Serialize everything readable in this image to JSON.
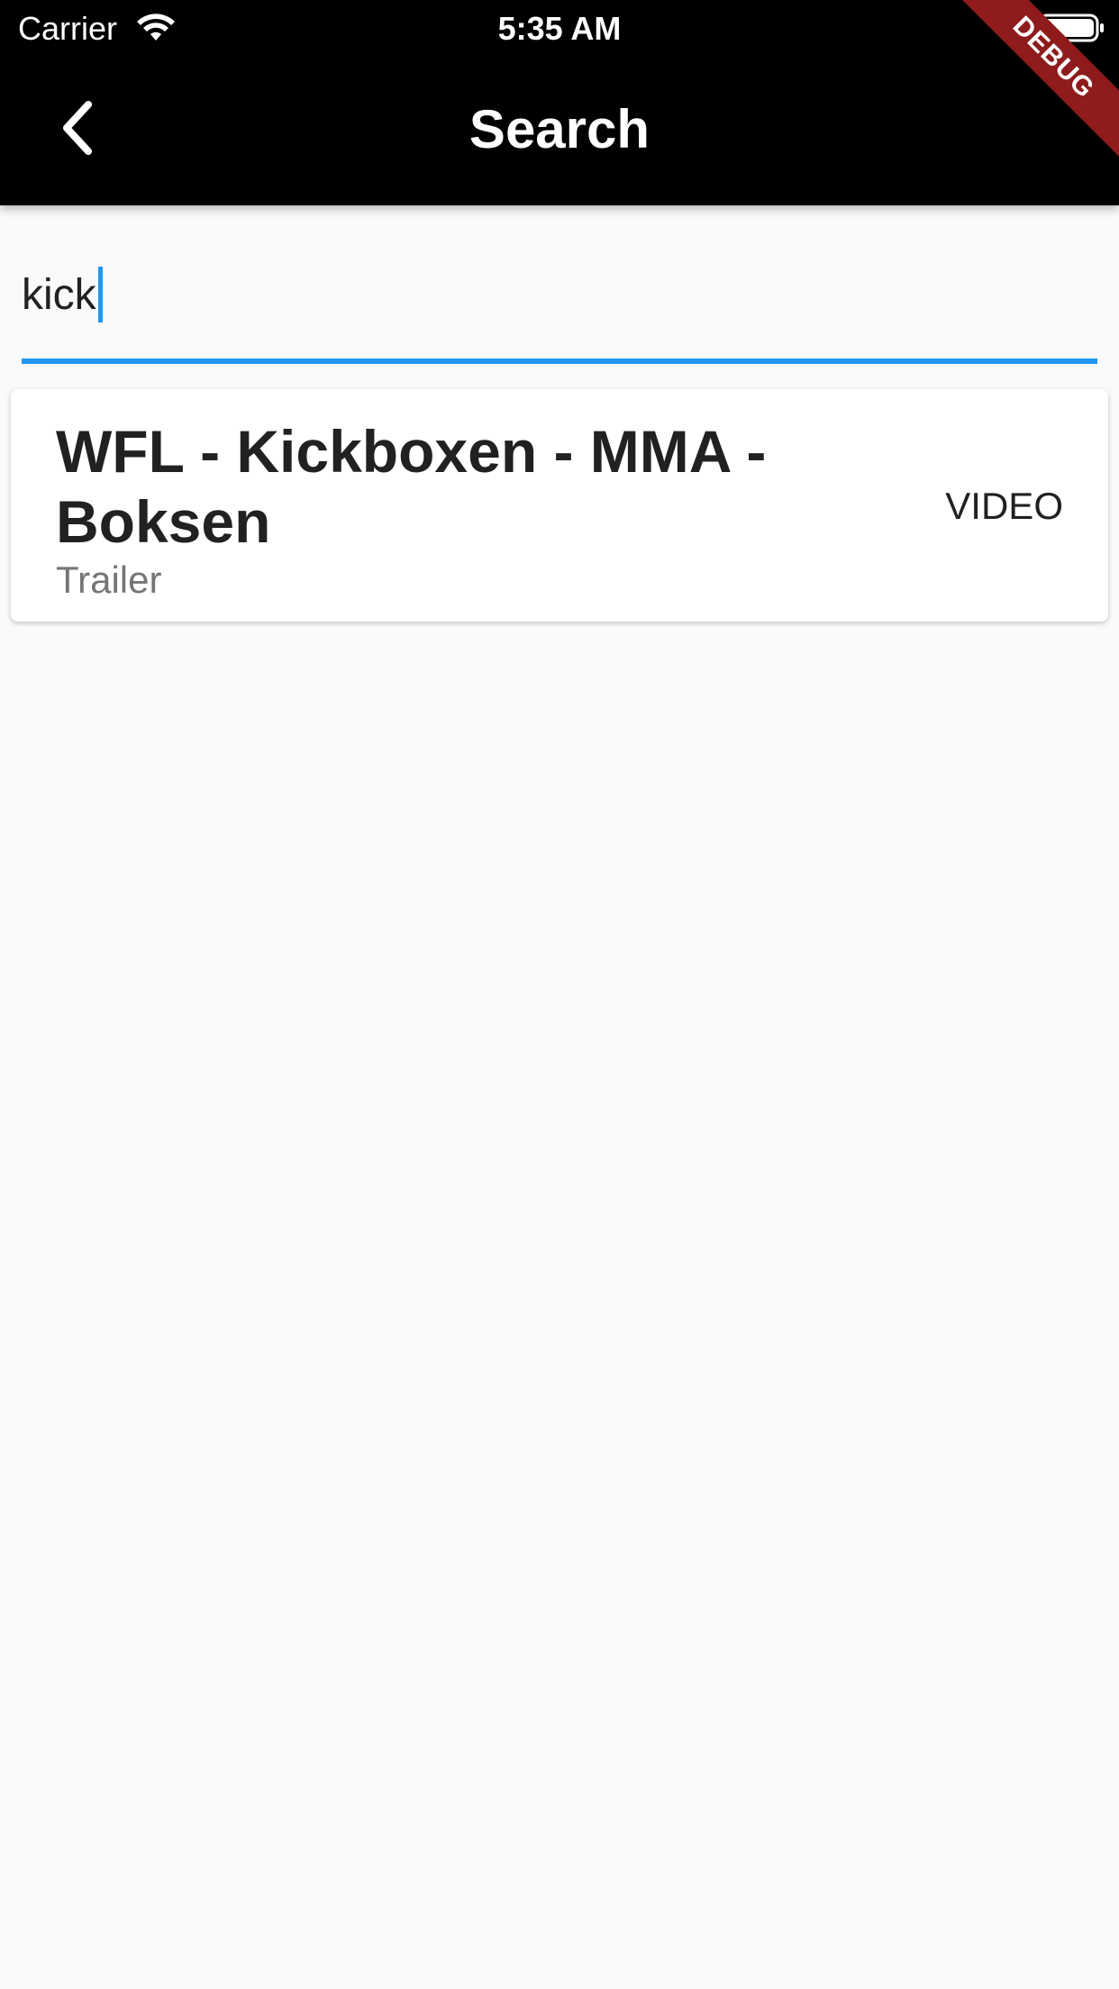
{
  "status_bar": {
    "carrier": "Carrier",
    "time": "5:35 AM",
    "wifi_icon": "wifi-icon",
    "battery_icon": "battery-full-icon"
  },
  "app_bar": {
    "title": "Search",
    "back_icon": "chevron-left-icon",
    "debug_banner": "DEBUG",
    "background_color": "#000000",
    "debug_color": "#8e1c1c"
  },
  "search": {
    "value": "kick",
    "accent_color": "#2196f3"
  },
  "results": [
    {
      "title": "WFL - Kickboxen - MMA - Boksen",
      "subtitle": "Trailer",
      "type": "VIDEO"
    }
  ]
}
